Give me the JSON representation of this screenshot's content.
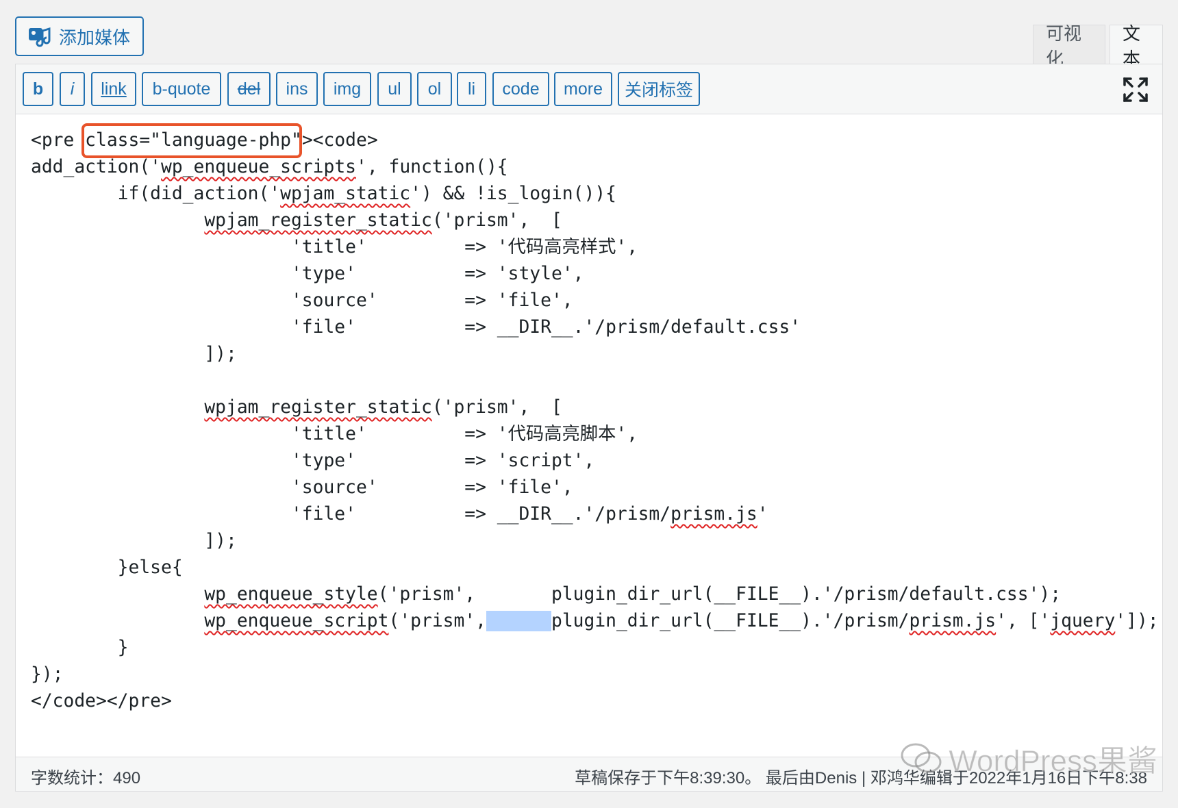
{
  "add_media": {
    "label": "添加媒体",
    "icon": "media-icon"
  },
  "tabs": [
    {
      "label": "可视化"
    },
    {
      "label": "文本"
    }
  ],
  "toolbar": {
    "buttons": [
      {
        "label": "b"
      },
      {
        "label": "i"
      },
      {
        "label": "link"
      },
      {
        "label": "b-quote"
      },
      {
        "label": "del"
      },
      {
        "label": "ins"
      },
      {
        "label": "img"
      },
      {
        "label": "ul"
      },
      {
        "label": "ol"
      },
      {
        "label": "li"
      },
      {
        "label": "code"
      },
      {
        "label": "more"
      },
      {
        "label": "关闭标签"
      }
    ],
    "fullscreen_icon": "fullscreen-icon"
  },
  "code_lines": [
    [
      [
        "<pre ",
        ""
      ],
      [
        "class=\"language-php\"",
        ""
      ],
      [
        "><code>",
        ""
      ]
    ],
    [
      [
        "add_action('",
        ""
      ],
      [
        "wp_enqueue_scripts",
        "sp"
      ],
      [
        "', function(){",
        ""
      ]
    ],
    [
      [
        "        if(did_action('",
        ""
      ],
      [
        "wpjam_static",
        "sp"
      ],
      [
        "') && !is_login()){",
        ""
      ]
    ],
    [
      [
        "                ",
        ""
      ],
      [
        "wpjam_register_static",
        "sp"
      ],
      [
        "('prism',  [",
        ""
      ]
    ],
    [
      [
        "                        'title'         => '代码高亮样式',",
        ""
      ]
    ],
    [
      [
        "                        'type'          => 'style',",
        ""
      ]
    ],
    [
      [
        "                        'source'        => 'file',",
        ""
      ]
    ],
    [
      [
        "                        'file'          => __DIR__.'/prism/default.css'",
        ""
      ]
    ],
    [
      [
        "                ]);",
        ""
      ]
    ],
    [
      [
        "",
        ""
      ]
    ],
    [
      [
        "                ",
        ""
      ],
      [
        "wpjam_register_static",
        "sp"
      ],
      [
        "('prism',  [",
        ""
      ]
    ],
    [
      [
        "                        'title'         => '代码高亮脚本',",
        ""
      ]
    ],
    [
      [
        "                        'type'          => 'script',",
        ""
      ]
    ],
    [
      [
        "                        'source'        => 'file',",
        ""
      ]
    ],
    [
      [
        "                        'file'          => __DIR__.'/prism/",
        ""
      ],
      [
        "prism.js",
        "sp"
      ],
      [
        "'",
        ""
      ]
    ],
    [
      [
        "                ]);",
        ""
      ]
    ],
    [
      [
        "        }else{",
        ""
      ]
    ],
    [
      [
        "                ",
        ""
      ],
      [
        "wp_enqueue_style",
        "sp"
      ],
      [
        "('prism',       plugin_dir_url(__FILE__).'/prism/default.css');",
        ""
      ]
    ],
    [
      [
        "                ",
        ""
      ],
      [
        "wp_enqueue_script",
        "sp"
      ],
      [
        "('prism',",
        ""
      ],
      [
        "      ",
        "sel"
      ],
      [
        "plugin_dir_url(__FILE__).'/prism/",
        ""
      ],
      [
        "prism.js",
        "sp"
      ],
      [
        "', ['",
        ""
      ],
      [
        "jquery",
        "sp"
      ],
      [
        "']);",
        ""
      ]
    ],
    [
      [
        "        }",
        ""
      ]
    ],
    [
      [
        "});",
        ""
      ]
    ],
    [
      [
        "</code></pre>",
        ""
      ]
    ]
  ],
  "status": {
    "word_count": "字数统计：490",
    "draft_info": "草稿保存于下午8:39:30。 最后由Denis | 邓鸿华编辑于2022年1月16日下午8:38"
  },
  "watermark": {
    "text": "WordPress果酱",
    "icon": "wechat-icon"
  },
  "colors": {
    "accent": "#2271b1",
    "highlight_box": "#e8532a",
    "selection": "#b4d3ff",
    "spell_underline": "#e02424"
  }
}
